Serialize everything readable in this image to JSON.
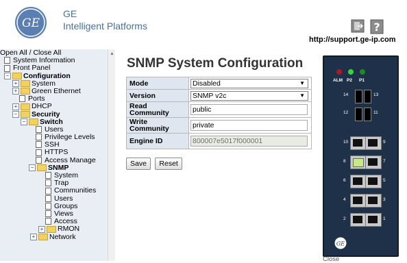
{
  "header": {
    "brand_line1": "GE",
    "brand_line2": "Intelligent Platforms",
    "support_url": "http://support.ge-ip.com",
    "logo_icon": "ge-logo-icon",
    "logout_icon": "logout-icon",
    "help_icon": "help-icon"
  },
  "sidebar": {
    "open_all": "Open All",
    "separator": "/",
    "close_all": "Close All",
    "items": [
      {
        "label": "System Information"
      },
      {
        "label": "Front Panel"
      },
      {
        "label": "Configuration"
      },
      {
        "label": "System"
      },
      {
        "label": "Green Ethernet"
      },
      {
        "label": "Ports"
      },
      {
        "label": "DHCP"
      },
      {
        "label": "Security"
      },
      {
        "label": "Switch"
      },
      {
        "label": "Users"
      },
      {
        "label": "Privilege Levels"
      },
      {
        "label": "SSH"
      },
      {
        "label": "HTTPS"
      },
      {
        "label": "Access Manage"
      },
      {
        "label": "SNMP"
      },
      {
        "label": "System"
      },
      {
        "label": "Trap"
      },
      {
        "label": "Communities"
      },
      {
        "label": "Users"
      },
      {
        "label": "Groups"
      },
      {
        "label": "Views"
      },
      {
        "label": "Access"
      },
      {
        "label": "RMON"
      },
      {
        "label": "Network"
      }
    ]
  },
  "main": {
    "title": "SNMP System Configuration",
    "rows": [
      {
        "label": "Mode",
        "value": "Disabled"
      },
      {
        "label": "Version",
        "value": "SNMP v2c"
      },
      {
        "label": "Read Community",
        "value": "public"
      },
      {
        "label": "Write Community",
        "value": "private"
      },
      {
        "label": "Engine ID",
        "value": "800007e5017f000001"
      }
    ],
    "save_label": "Save",
    "reset_label": "Reset"
  },
  "device": {
    "led_labels": [
      "ALM",
      "P2",
      "P1"
    ],
    "led_colors": [
      "#b0182a",
      "#39d43a",
      "#1e8a2a"
    ],
    "fiber_ports": [
      {
        "left": "14",
        "right": "13"
      },
      {
        "left": "12",
        "right": "11"
      }
    ],
    "rj_ports": [
      {
        "left": "10",
        "right": "9"
      },
      {
        "left": "8",
        "right": "7"
      },
      {
        "left": "6",
        "right": "5"
      },
      {
        "left": "4",
        "right": "3"
      },
      {
        "left": "2",
        "right": "1"
      }
    ],
    "close_label": "Close"
  }
}
